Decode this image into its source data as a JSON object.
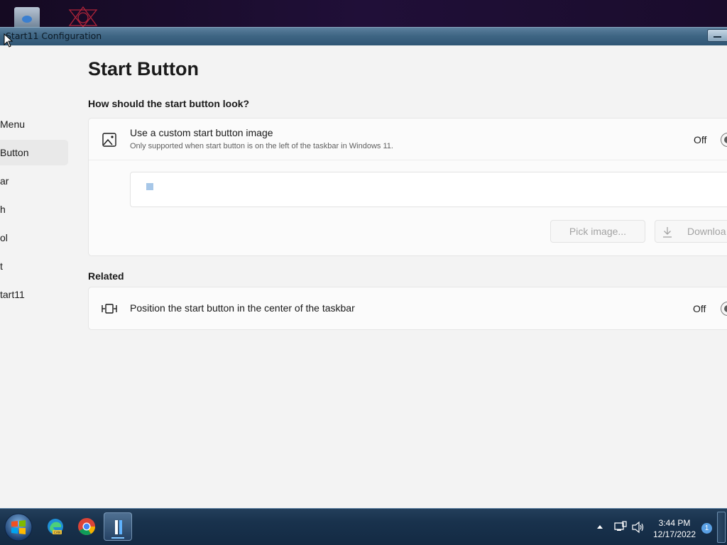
{
  "window": {
    "title": "Start11 Configuration"
  },
  "sidebar": {
    "items": [
      {
        "label": "Menu",
        "active": false
      },
      {
        "label": "Button",
        "active": true
      },
      {
        "label": "ar",
        "active": false
      },
      {
        "label": "h",
        "active": false
      },
      {
        "label": "ol",
        "active": false
      },
      {
        "label": "t",
        "active": false
      },
      {
        "label": "tart11",
        "active": false
      }
    ]
  },
  "page": {
    "title": "Start Button",
    "section_look": "How should the start button look?",
    "section_related": "Related"
  },
  "custom_image": {
    "title": "Use a custom start button image",
    "subtitle": "Only supported when start button is on the left of the taskbar in Windows 11.",
    "toggle_label": "Off",
    "toggle_on": false,
    "icon": "image-icon",
    "pick_button": "Pick image...",
    "download_button": "Downloa",
    "download_icon": "download-arrow-icon"
  },
  "center_position": {
    "title": "Position the start button in the center of the taskbar",
    "toggle_label": "Off",
    "toggle_on": false,
    "icon": "center-align-icon"
  },
  "taskbar": {
    "apps": [
      "edge-can-icon",
      "chrome-icon",
      "start11-icon"
    ],
    "time": "3:44 PM",
    "date": "12/17/2022",
    "notification_count": "1"
  },
  "colors": {
    "accent": "#3b7fd0",
    "window_bg": "#f3f3f3",
    "card_bg": "#fbfbfb",
    "taskbar_bg": "#132a43"
  }
}
